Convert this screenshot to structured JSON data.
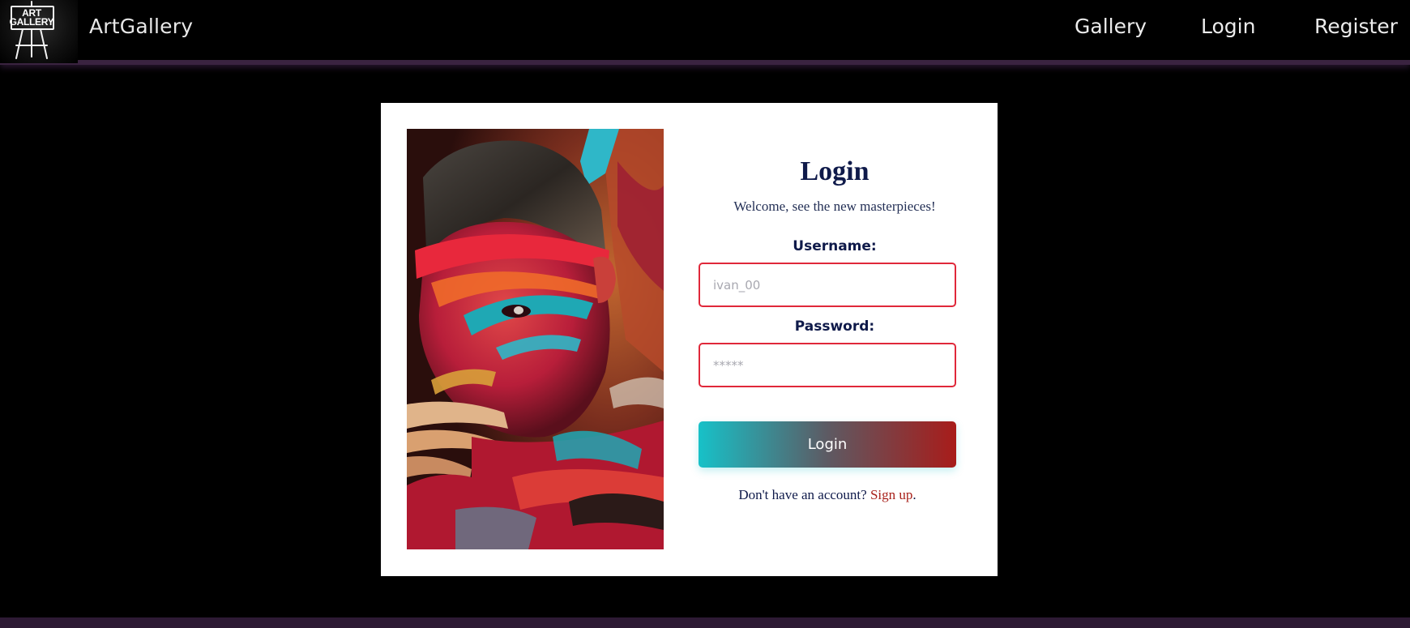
{
  "nav": {
    "logo_line1": "ART",
    "logo_line2": "GALLERY",
    "brand": "ArtGallery",
    "links": [
      "Gallery",
      "Login",
      "Register"
    ]
  },
  "image": {
    "icon": "painted-face-portrait"
  },
  "login": {
    "title": "Login",
    "subtitle": "Welcome, see the new masterpieces!",
    "username_label": "Username:",
    "username_placeholder": "ivan_00",
    "password_label": "Password:",
    "password_placeholder": "*****",
    "button": "Login",
    "signup_prompt": "Don't have an account? ",
    "signup_link": "Sign up",
    "signup_suffix": "."
  },
  "colors": {
    "background": "#000000",
    "navy": "#0f1a4a",
    "input_border": "#e0283a",
    "button_start": "#17c1c8",
    "button_end": "#a81c1a",
    "link": "#a8201a",
    "nav_bar_border": "#3a2340"
  }
}
